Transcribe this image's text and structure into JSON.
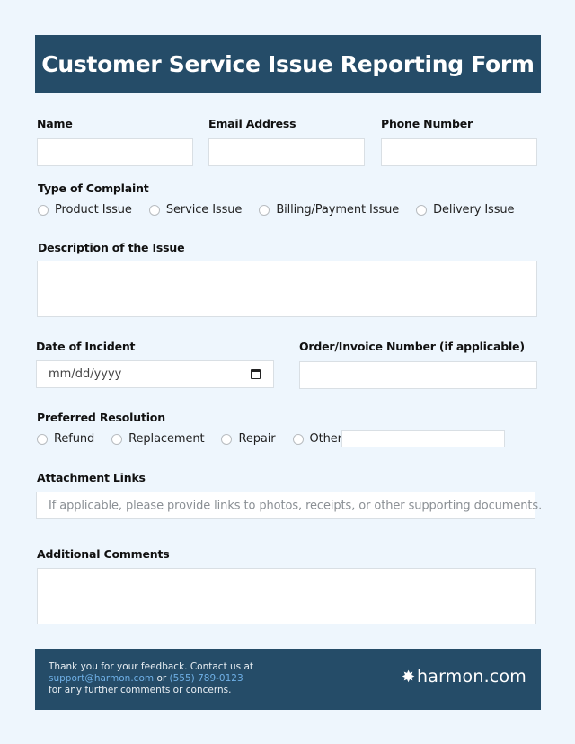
{
  "header": {
    "title": "Customer Service Issue Reporting Form"
  },
  "fields": {
    "name": {
      "label": "Name",
      "value": ""
    },
    "email": {
      "label": "Email Address",
      "value": ""
    },
    "phone": {
      "label": "Phone Number",
      "value": ""
    },
    "description": {
      "label": "Description of the Issue",
      "value": ""
    },
    "date": {
      "label": "Date of Incident",
      "placeholder": "mm/dd/yyyy",
      "icon": "calendar-icon"
    },
    "order": {
      "label": "Order/Invoice Number (if applicable)",
      "value": ""
    },
    "attachments": {
      "label": "Attachment Links",
      "placeholder": "If applicable, please provide links to photos, receipts, or other supporting documents."
    },
    "comments": {
      "label": "Additional Comments",
      "value": ""
    }
  },
  "complaint_type": {
    "label": "Type of Complaint",
    "options": [
      "Product Issue",
      "Service Issue",
      "Billing/Payment Issue",
      "Delivery Issue"
    ]
  },
  "resolution": {
    "label": "Preferred Resolution",
    "options": [
      "Refund",
      "Replacement",
      "Repair",
      "Other:"
    ],
    "other_value": ""
  },
  "footer": {
    "line1": "Thank you for your feedback. Contact us at",
    "email": "support@harmon.com",
    "or": " or ",
    "phone": "(555) 789-0123",
    "line3": "for any further comments or concerns.",
    "logo_icon": "✸",
    "logo_text": "harmon.com"
  },
  "colors": {
    "primary": "#254c68",
    "background": "#eef6fd",
    "link": "#6fb0e6"
  }
}
